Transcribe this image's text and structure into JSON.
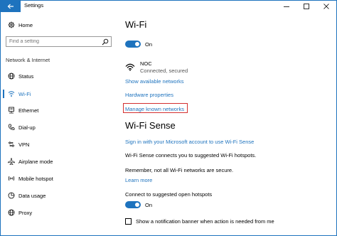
{
  "window": {
    "title": "Settings"
  },
  "sidebar": {
    "home_label": "Home",
    "search_placeholder": "Find a setting",
    "section_label": "Network & Internet",
    "items": [
      {
        "label": "Status",
        "icon": "globe-icon"
      },
      {
        "label": "Wi-Fi",
        "icon": "wifi-icon"
      },
      {
        "label": "Ethernet",
        "icon": "ethernet-icon"
      },
      {
        "label": "Dial-up",
        "icon": "phone-icon"
      },
      {
        "label": "VPN",
        "icon": "vpn-icon"
      },
      {
        "label": "Airplane mode",
        "icon": "airplane-icon"
      },
      {
        "label": "Mobile hotspot",
        "icon": "hotspot-icon"
      },
      {
        "label": "Data usage",
        "icon": "data-usage-icon"
      },
      {
        "label": "Proxy",
        "icon": "globe-icon"
      }
    ],
    "active_item": "Wi-Fi"
  },
  "main": {
    "wifi_heading": "Wi-Fi",
    "wifi_toggle_label": "On",
    "network": {
      "name": "NOC",
      "status": "Connected, secured"
    },
    "show_networks_link": "Show available networks",
    "hardware_link": "Hardware properties",
    "manage_link": "Manage known networks",
    "sense_heading": "Wi-Fi Sense",
    "sign_in_link": "Sign in with your Microsoft account to use Wi-Fi Sense",
    "sense_desc": "Wi-Fi Sense connects you to suggested Wi-Fi hotspots.",
    "sense_note": "Remember, not all Wi-Fi networks are secure.",
    "learn_more_link": "Learn more",
    "hotspots_label": "Connect to suggested open hotspots",
    "hotspots_toggle_label": "On",
    "notification_checkbox_label": "Show a notification banner when action is needed from me"
  },
  "colors": {
    "accent": "#1e73be",
    "highlight": "#d32f2f"
  }
}
